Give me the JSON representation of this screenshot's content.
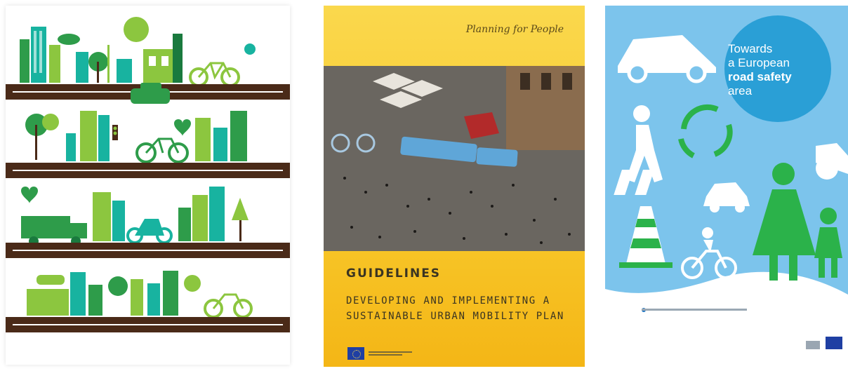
{
  "panels": {
    "city_illustration": {},
    "guidelines_cover": {
      "tagline": "Planning for People",
      "heading": "GUIDELINES",
      "subheading_line1": "DEVELOPING AND IMPLEMENTING A",
      "subheading_line2": "SUSTAINABLE URBAN MOBILITY PLAN"
    },
    "road_safety_cover": {
      "title_line1": "Towards",
      "title_line2": "a European",
      "title_line3": "road safety",
      "title_line4": "area"
    }
  },
  "colors": {
    "road": "#4a2a18",
    "green_dark": "#2e9c4a",
    "green_light": "#8cc63f",
    "teal": "#18b3a0",
    "cover_yellow": "#f8c92c",
    "sky_blue": "#7cc4ec",
    "pictogram_green": "#2bb24a",
    "pictogram_white": "#ffffff"
  },
  "icons": [
    "bicycle-icon",
    "car-icon",
    "truck-icon",
    "scooter-icon",
    "tree-icon",
    "heart-icon",
    "traffic-light-icon",
    "pedestrian-icon",
    "traffic-cone-icon",
    "recycle-arrows-icon",
    "eu-flag-icon"
  ]
}
